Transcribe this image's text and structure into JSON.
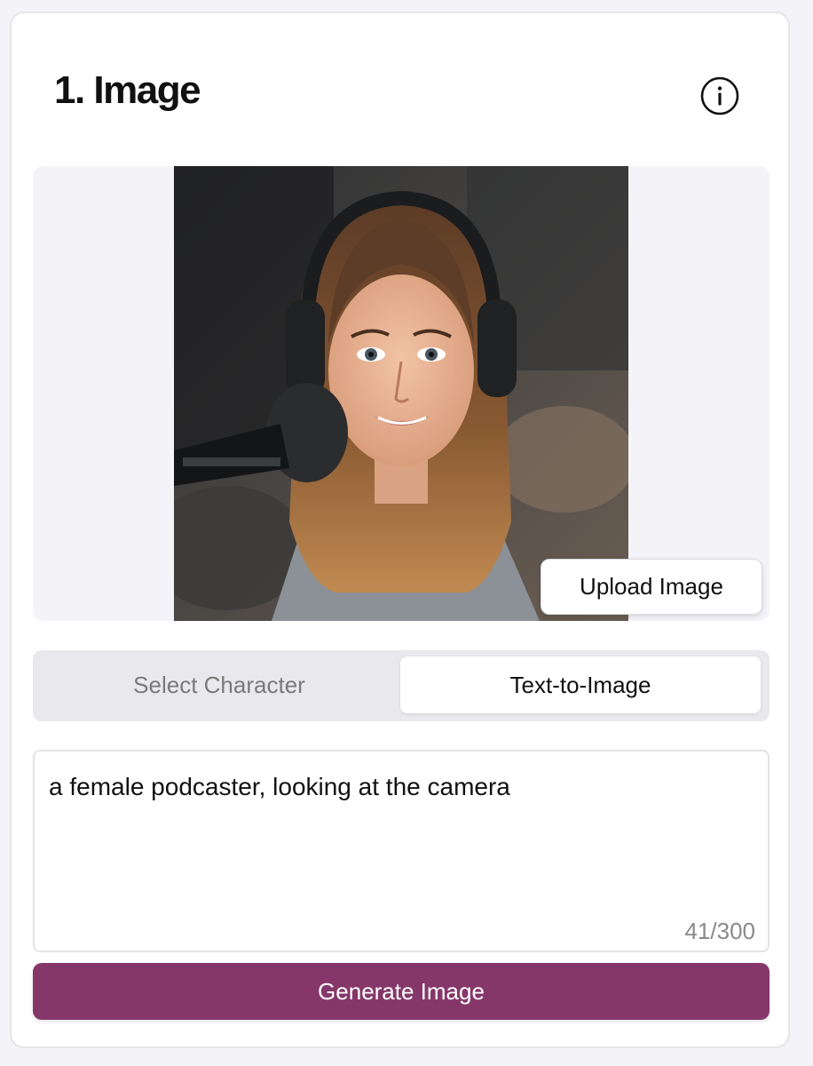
{
  "panel": {
    "title": "1. Image",
    "info_icon": "info-circle-icon"
  },
  "preview": {
    "upload_label": "Upload Image"
  },
  "tabs": [
    {
      "label": "Select Character",
      "active": false
    },
    {
      "label": "Text-to-Image",
      "active": true
    }
  ],
  "prompt": {
    "value": "a female podcaster, looking at the camera",
    "counter": "41/300"
  },
  "generate": {
    "label": "Generate Image"
  },
  "colors": {
    "accent": "#85376a",
    "page_bg": "#f4f3f8",
    "tab_track": "#e9e8ec"
  }
}
